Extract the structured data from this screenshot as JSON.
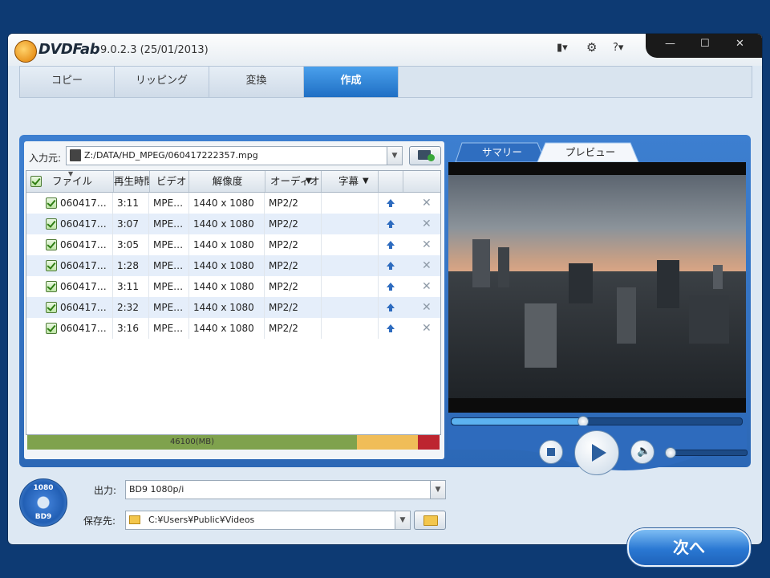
{
  "app": {
    "name": "DVDFab",
    "version": "9.0.2.3 (25/01/2013)"
  },
  "titlebar": {
    "skin_icon": "▮▾",
    "settings_icon": "⚙",
    "help_icon": "?▾",
    "minimize": "—",
    "maximize": "☐",
    "close": "✕"
  },
  "tabs": [
    "コピー",
    "リッピング",
    "変換",
    "作成"
  ],
  "active_tab": "作成",
  "input": {
    "label": "入力元:",
    "path": "Z:/DATA/HD_MPEG/060417222357.mpg"
  },
  "table": {
    "headers": {
      "file": "ファイル",
      "duration": "再生時間",
      "video": "ビデオ",
      "resolution": "解像度",
      "audio": "オーディオ",
      "subtitle": "字幕"
    },
    "rows": [
      {
        "file": "060417…",
        "duration": "3:11",
        "video": "MPE…",
        "resolution": "1440 x 1080",
        "audio": "MP2/2",
        "remove": "✕"
      },
      {
        "file": "060417…",
        "duration": "3:07",
        "video": "MPE…",
        "resolution": "1440 x 1080",
        "audio": "MP2/2",
        "remove": "✕"
      },
      {
        "file": "060417…",
        "duration": "3:05",
        "video": "MPE…",
        "resolution": "1440 x 1080",
        "audio": "MP2/2",
        "remove": "✕"
      },
      {
        "file": "060417…",
        "duration": "1:28",
        "video": "MPE…",
        "resolution": "1440 x 1080",
        "audio": "MP2/2",
        "remove": "✕"
      },
      {
        "file": "060417…",
        "duration": "3:11",
        "video": "MPE…",
        "resolution": "1440 x 1080",
        "audio": "MP2/2",
        "remove": "✕"
      },
      {
        "file": "060417…",
        "duration": "2:32",
        "video": "MPE…",
        "resolution": "1440 x 1080",
        "audio": "MP2/2",
        "remove": "✕"
      },
      {
        "file": "060417…",
        "duration": "3:16",
        "video": "MPE…",
        "resolution": "1440 x 1080",
        "audio": "MP2/2",
        "remove": "✕"
      }
    ]
  },
  "capacity": {
    "label": "46100(MB)",
    "used_fraction": 0.8,
    "colors": {
      "used": "#7fa24d",
      "warning": "#f0bd58",
      "over": "#bd2530"
    }
  },
  "preview": {
    "tabs": [
      "サマリー",
      "プレビュー"
    ],
    "active_tab": "プレビュー",
    "seek_fraction": 0.45,
    "volume_fraction": 0.0
  },
  "bottom": {
    "disc_top": "1080",
    "disc_bottom": "BD9",
    "output_label": "出力:",
    "output_value": "BD9 1080p/i",
    "save_label": "保存先:",
    "save_path": "C:¥Users¥Public¥Videos",
    "next_button": "次へ"
  },
  "colors": {
    "background": "#0d3a73",
    "accent": "#1f6fc4"
  }
}
